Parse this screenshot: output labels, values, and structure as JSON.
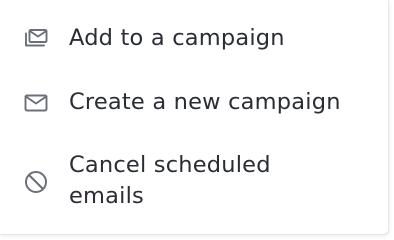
{
  "menu": {
    "items": [
      {
        "label": "Add to a campaign",
        "icon": "stacked-mail-icon"
      },
      {
        "label": "Create a new campaign",
        "icon": "envelope-icon"
      },
      {
        "label_lines": [
          "Cancel scheduled",
          "emails"
        ],
        "icon": "cancel-icon"
      }
    ]
  },
  "colors": {
    "text": "#2a2d34",
    "icon": "#6b6f78",
    "border": "#e6e7ea"
  }
}
